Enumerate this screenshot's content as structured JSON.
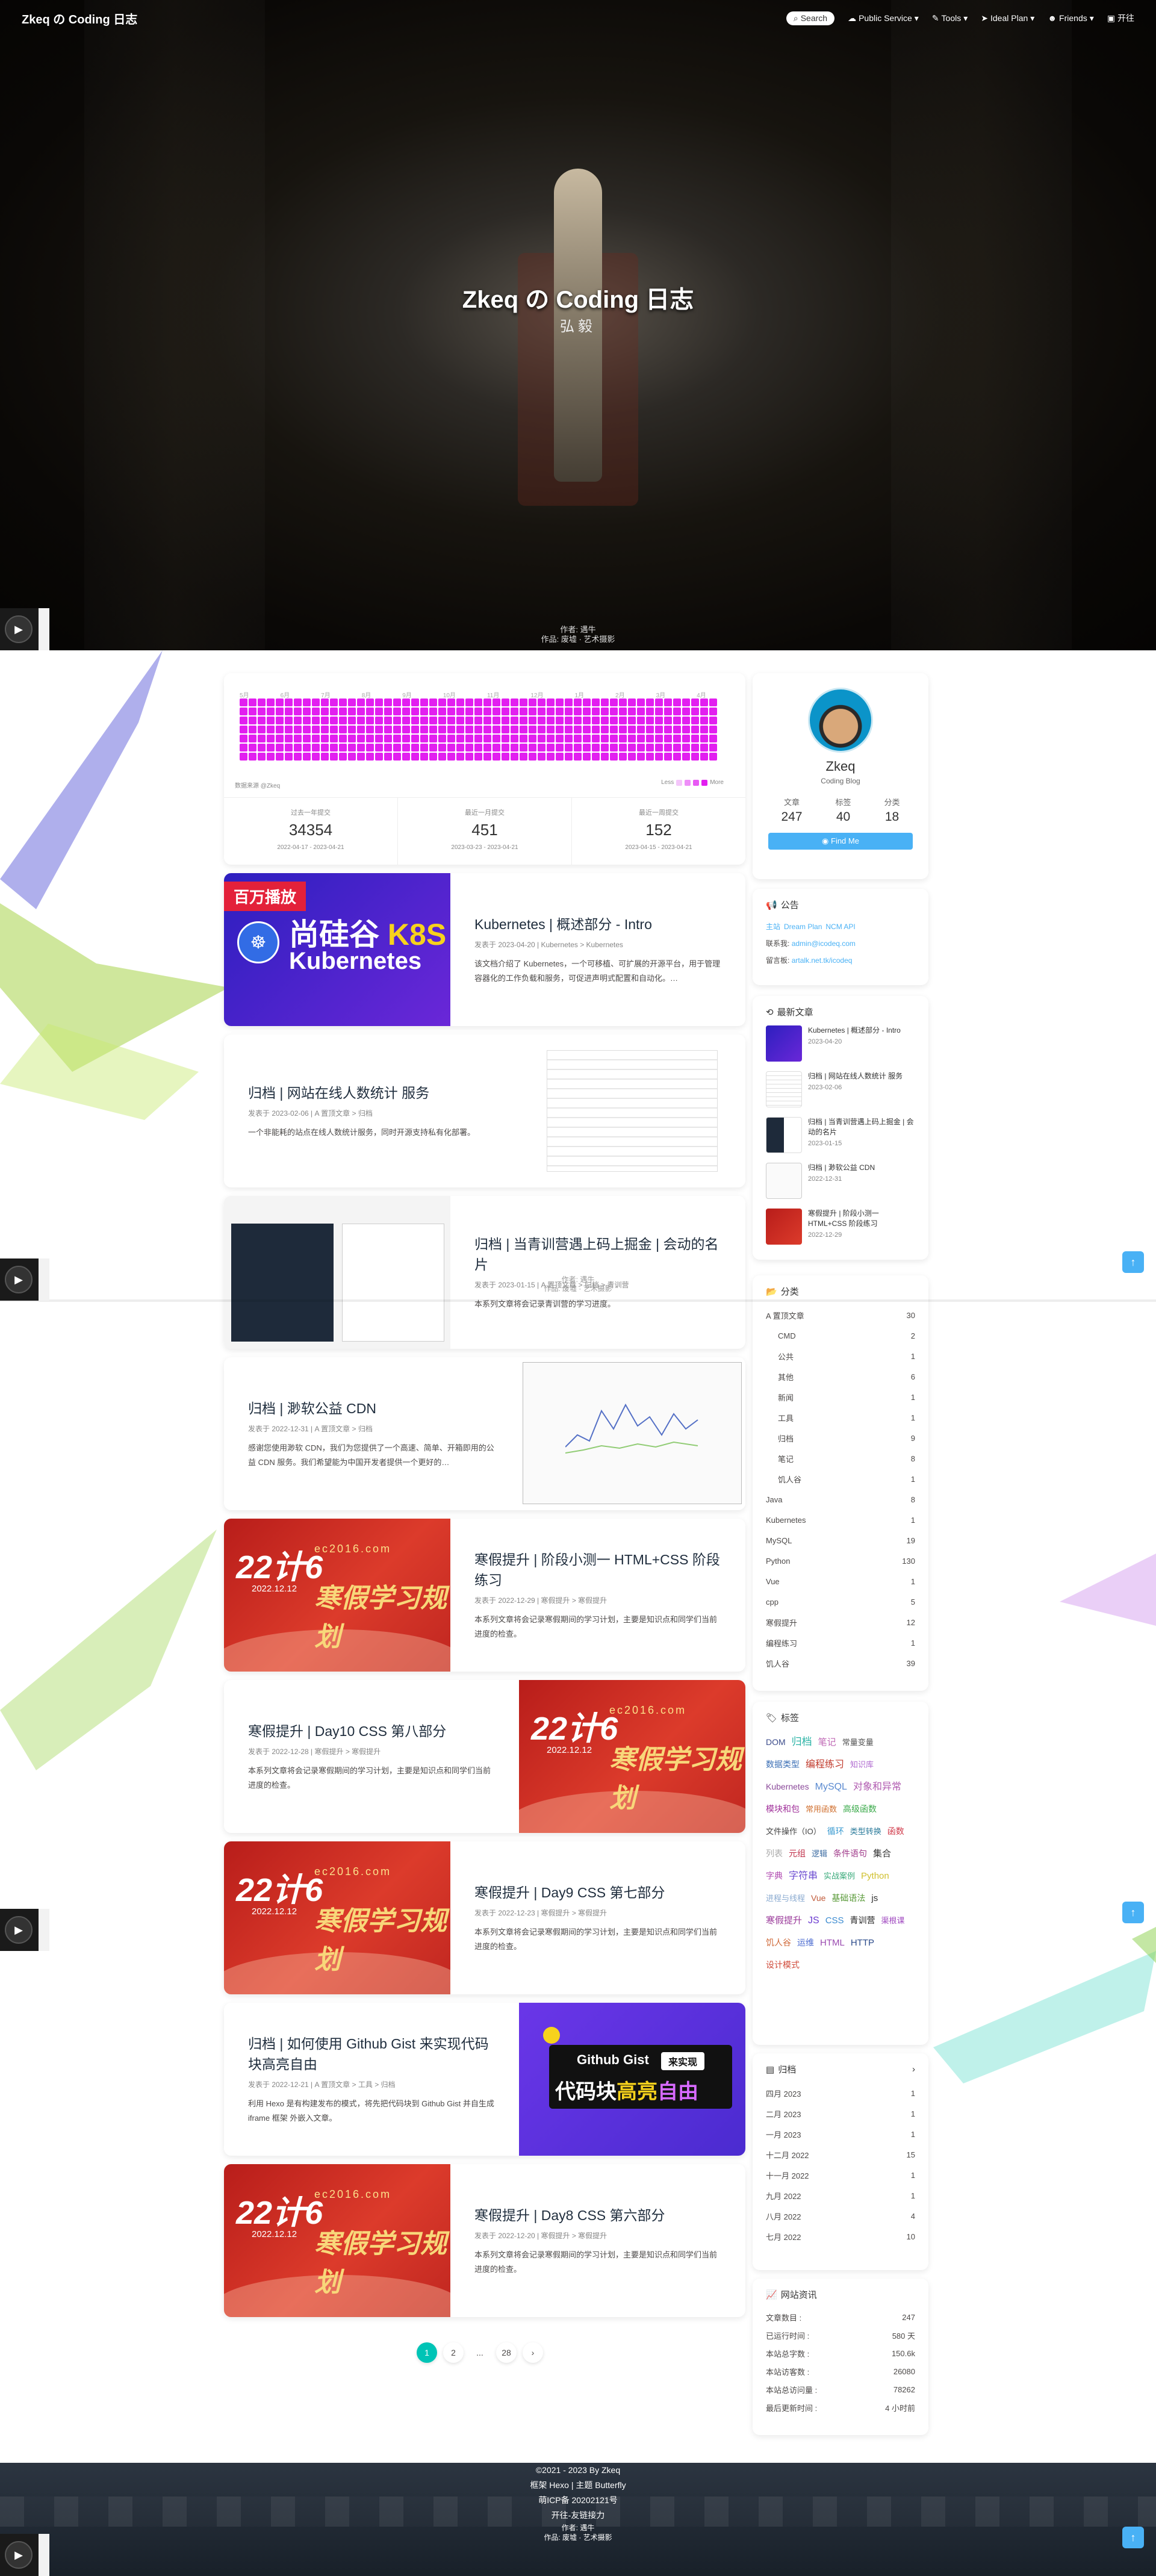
{
  "site_name": "Zkeq の Coding 日志",
  "nav": {
    "search": "Search",
    "items": [
      {
        "label": "Public Service"
      },
      {
        "label": "Tools"
      },
      {
        "label": "Ideal Plan"
      },
      {
        "label": "Friends"
      },
      {
        "label": "开往"
      }
    ]
  },
  "hero": {
    "title": "Zkeq の Coding 日志",
    "subtitle": "弘毅",
    "credit_1": "作者: 遇牛",
    "credit_2": "作品: 废墟 · 艺术摄影"
  },
  "mid_credit": {
    "line1": "作者: 遇牛",
    "line2": "作品: 废墟 · 艺术摄影"
  },
  "heatmap": {
    "months": [
      "5月",
      "6月",
      "7月",
      "8月",
      "9月",
      "10月",
      "11月",
      "12月",
      "1月",
      "2月",
      "3月",
      "4月"
    ],
    "source": "数据来源 @Zkeq",
    "legend_less": "Less",
    "legend_more": "More",
    "stats": [
      {
        "label": "过去一年提交",
        "value": "34354",
        "range": "2022-04-17 - 2023-04-21"
      },
      {
        "label": "最近一月提交",
        "value": "451",
        "range": "2023-03-23 - 2023-04-21"
      },
      {
        "label": "最近一周提交",
        "value": "152",
        "range": "2023-04-15 - 2023-04-21"
      }
    ]
  },
  "posts": [
    {
      "title": "Kubernetes | 概述部分 - Intro",
      "meta": "发表于 2023-04-20 | Kubernetes > Kubernetes",
      "excerpt": "该文档介绍了 Kubernetes，一个可移植、可扩展的开源平台，用于管理容器化的工作负载和服务，可促进声明式配置和自动化。…",
      "cover": {
        "badge": "百万播放",
        "t1a": "尚硅谷 ",
        "t1b": "K8S",
        "t2": "Kubernetes"
      }
    },
    {
      "title": "归档 | 网站在线人数统计 服务",
      "meta": "发表于 2023-02-06 | A 置顶文章 > 归档",
      "excerpt": "一个非能耗的站点在线人数统计服务，同时开源支持私有化部署。"
    },
    {
      "title": "归档 | 当青训营遇上码上掘金 | 会动的名片",
      "meta": "发表于 2023-01-15 | A 置顶文章 > 归档 > 青训营",
      "excerpt": "本系列文章将会记录青训营的学习进度。"
    },
    {
      "title": "归档 | 渺软公益 CDN",
      "meta": "发表于 2022-12-31 | A 置顶文章 > 归档",
      "excerpt": "感谢您使用渺软 CDN，我们为您提供了一个高速、简单、开箱即用的公益 CDN 服务。我们希望能为中国开发者提供一个更好的…"
    },
    {
      "title": "寒假提升 | 阶段小测一 HTML+CSS 阶段练习",
      "meta": "发表于 2022-12-29 | 寒假提升 > 寒假提升",
      "excerpt": "本系列文章将会记录寒假期间的学习计划，主要是知识点和同学们当前进度的检查。",
      "cover": {
        "big": "22计6",
        "url": "ec2016.com",
        "date": "2022.12.12",
        "slogan": "寒假学习规划"
      }
    },
    {
      "title": "寒假提升 | Day10 CSS 第八部分",
      "meta": "发表于 2022-12-28 | 寒假提升 > 寒假提升",
      "excerpt": "本系列文章将会记录寒假期间的学习计划，主要是知识点和同学们当前进度的检查。",
      "cover": {
        "big": "22计6",
        "url": "ec2016.com",
        "date": "2022.12.12",
        "slogan": "寒假学习规划"
      }
    },
    {
      "title": "寒假提升 | Day9 CSS 第七部分",
      "meta": "发表于 2022-12-23 | 寒假提升 > 寒假提升",
      "excerpt": "本系列文章将会记录寒假期间的学习计划，主要是知识点和同学们当前进度的检查。",
      "cover": {
        "big": "22计6",
        "url": "ec2016.com",
        "date": "2022.12.12",
        "slogan": "寒假学习规划"
      }
    },
    {
      "title": "归档 | 如何使用 Github Gist 来实现代码块高亮自由",
      "meta": "发表于 2022-12-21 | A 置顶文章 > 工具 > 归档",
      "excerpt": "利用 Hexo 是有构建发布的模式，将先把代码块到 Github Gist 并自生成 iframe 框架 外嵌入文章。",
      "cover": {
        "t1": "Github Gist",
        "tag": "来实现",
        "t2a": "代码块",
        "t2b": "高亮",
        "t2c": "自由"
      }
    },
    {
      "title": "寒假提升 | Day8 CSS 第六部分",
      "meta": "发表于 2022-12-20 | 寒假提升 > 寒假提升",
      "excerpt": "本系列文章将会记录寒假期间的学习计划，主要是知识点和同学们当前进度的检查。",
      "cover": {
        "big": "22计6",
        "url": "ec2016.com",
        "date": "2022.12.12",
        "slogan": "寒假学习规划"
      }
    }
  ],
  "pager": {
    "p1": "1",
    "p2": "2",
    "dots": "...",
    "last": "28",
    "next": "›"
  },
  "author": {
    "name": "Zkeq",
    "desc": "Coding Blog",
    "stats": [
      {
        "label": "文章",
        "value": "247"
      },
      {
        "label": "标签",
        "value": "40"
      },
      {
        "label": "分类",
        "value": "18"
      }
    ],
    "follow": "Find Me"
  },
  "announce": {
    "title": "公告",
    "l1a": "主站",
    "l1b": "Dream Plan",
    "l1c": "NCM API",
    "l2a": "联系我:",
    "l2b": "admin@icodeq.com",
    "l3a": "留言板:",
    "l3b": "artalk.net.tk/icodeq"
  },
  "recent": {
    "title": "最新文章",
    "items": [
      {
        "title": "Kubernetes | 概述部分 - Intro",
        "date": "2023-04-20"
      },
      {
        "title": "归档 | 网站在线人数统计 服务",
        "date": "2023-02-06"
      },
      {
        "title": "归档 | 当青训营遇上码上掘金 | 会动的名片",
        "date": "2023-01-15"
      },
      {
        "title": "归档 | 渺软公益 CDN",
        "date": "2022-12-31"
      },
      {
        "title": "寒假提升 | 阶段小测一 HTML+CSS 阶段练习",
        "date": "2022-12-29"
      }
    ]
  },
  "categories": {
    "title": "分类",
    "items": [
      {
        "name": "A 置顶文章",
        "count": "30",
        "sub": false
      },
      {
        "name": "CMD",
        "count": "2",
        "sub": true
      },
      {
        "name": "公共",
        "count": "1",
        "sub": true
      },
      {
        "name": "其他",
        "count": "6",
        "sub": true
      },
      {
        "name": "新闻",
        "count": "1",
        "sub": true
      },
      {
        "name": "工具",
        "count": "1",
        "sub": true
      },
      {
        "name": "归档",
        "count": "9",
        "sub": true
      },
      {
        "name": "笔记",
        "count": "8",
        "sub": true
      },
      {
        "name": "饥人谷",
        "count": "1",
        "sub": true
      },
      {
        "name": "Java",
        "count": "8",
        "sub": false
      },
      {
        "name": "Kubernetes",
        "count": "1",
        "sub": false
      },
      {
        "name": "MySQL",
        "count": "19",
        "sub": false
      },
      {
        "name": "Python",
        "count": "130",
        "sub": false
      },
      {
        "name": "Vue",
        "count": "1",
        "sub": false
      },
      {
        "name": "cpp",
        "count": "5",
        "sub": false
      },
      {
        "name": "寒假提升",
        "count": "12",
        "sub": false
      },
      {
        "name": "编程练习",
        "count": "1",
        "sub": false
      },
      {
        "name": "饥人谷",
        "count": "39",
        "sub": false
      }
    ]
  },
  "tags": {
    "title": "标签",
    "items": [
      {
        "name": "DOM",
        "color": "#3a4a8a",
        "size": 14
      },
      {
        "name": "归档",
        "color": "#2bb3a6",
        "size": 17
      },
      {
        "name": "笔记",
        "color": "#c06ab6",
        "size": 15
      },
      {
        "name": "常量变量",
        "color": "#555555",
        "size": 13
      },
      {
        "name": "数据类型",
        "color": "#3b6fb5",
        "size": 14
      },
      {
        "name": "编程练习",
        "color": "#c0392b",
        "size": 16
      },
      {
        "name": "知识库",
        "color": "#b06ad0",
        "size": 13
      },
      {
        "name": "Kubernetes",
        "color": "#8b4a9a",
        "size": 14
      },
      {
        "name": "MySQL",
        "color": "#5a8ad0",
        "size": 16
      },
      {
        "name": "对象和异常",
        "color": "#b05ab0",
        "size": 16
      },
      {
        "name": "模块和包",
        "color": "#a0309a",
        "size": 14
      },
      {
        "name": "常用函数",
        "color": "#d07030",
        "size": 13
      },
      {
        "name": "高级函数",
        "color": "#3aaa4a",
        "size": 14
      },
      {
        "name": "文件操作（IO）",
        "color": "#444444",
        "size": 13
      },
      {
        "name": "循环",
        "color": "#3a9ad0",
        "size": 14
      },
      {
        "name": "类型转换",
        "color": "#2a7a9a",
        "size": 13
      },
      {
        "name": "函数",
        "color": "#d03a4a",
        "size": 14
      },
      {
        "name": "列表",
        "color": "#aaaaaa",
        "size": 14
      },
      {
        "name": "元组",
        "color": "#c0304a",
        "size": 14
      },
      {
        "name": "逻辑",
        "color": "#3a6aa0",
        "size": 13
      },
      {
        "name": "条件语句",
        "color": "#a03a8a",
        "size": 14
      },
      {
        "name": "集合",
        "color": "#333333",
        "size": 15
      },
      {
        "name": "字典",
        "color": "#b04ab0",
        "size": 14
      },
      {
        "name": "字符串",
        "color": "#6a4ad0",
        "size": 16
      },
      {
        "name": "实战案例",
        "color": "#3aaa7a",
        "size": 13
      },
      {
        "name": "Python",
        "color": "#d0c030",
        "size": 15
      },
      {
        "name": "进程与线程",
        "color": "#8aaad0",
        "size": 13
      },
      {
        "name": "Vue",
        "color": "#c05a3a",
        "size": 14
      },
      {
        "name": "基础语法",
        "color": "#5a9a3a",
        "size": 14
      },
      {
        "name": "js",
        "color": "#333333",
        "size": 15
      },
      {
        "name": "寒假提升",
        "color": "#9a3a9a",
        "size": 15
      },
      {
        "name": "JS",
        "color": "#6a3ad0",
        "size": 16
      },
      {
        "name": "CSS",
        "color": "#3a8ad0",
        "size": 15
      },
      {
        "name": "青训营",
        "color": "#222222",
        "size": 14
      },
      {
        "name": "渠根课",
        "color": "#a04ac0",
        "size": 13
      },
      {
        "name": "饥人谷",
        "color": "#d06a3a",
        "size": 14
      },
      {
        "name": "运维",
        "color": "#4a6ad0",
        "size": 14
      },
      {
        "name": "HTML",
        "color": "#9a4ab0",
        "size": 15
      },
      {
        "name": "HTTP",
        "color": "#2a4a8a",
        "size": 15
      },
      {
        "name": "设计模式",
        "color": "#d04a3a",
        "size": 14
      }
    ]
  },
  "archives": {
    "title": "归档",
    "items": [
      {
        "name": "四月 2023",
        "count": "1"
      },
      {
        "name": "二月 2023",
        "count": "1"
      },
      {
        "name": "一月 2023",
        "count": "1"
      },
      {
        "name": "十二月 2022",
        "count": "15"
      },
      {
        "name": "十一月 2022",
        "count": "1"
      },
      {
        "name": "九月 2022",
        "count": "1"
      },
      {
        "name": "八月 2022",
        "count": "4"
      },
      {
        "name": "七月 2022",
        "count": "10"
      }
    ]
  },
  "siteinfo": {
    "title": "网站资讯",
    "items": [
      {
        "name": "文章数目 :",
        "value": "247"
      },
      {
        "name": "已运行时间 :",
        "value": "580 天"
      },
      {
        "name": "本站总字数 :",
        "value": "150.6k"
      },
      {
        "name": "本站访客数 :",
        "value": "26080"
      },
      {
        "name": "本站总访问量 :",
        "value": "78262"
      },
      {
        "name": "最后更新时间 :",
        "value": "4 小时前"
      }
    ]
  },
  "footer": {
    "line1": "©2021 - 2023 By Zkeq",
    "line2": "框架 Hexo | 主题 Butterfly",
    "line3": "萌ICP备 20202121号",
    "line4": "开往-友链接力",
    "line5": "作者: 遇牛",
    "line6": "作品: 废墟 · 艺术摄影"
  },
  "colors": {
    "accent": "#49b1f5",
    "heat": "#e21ff0",
    "pager": "#00c4b6"
  }
}
